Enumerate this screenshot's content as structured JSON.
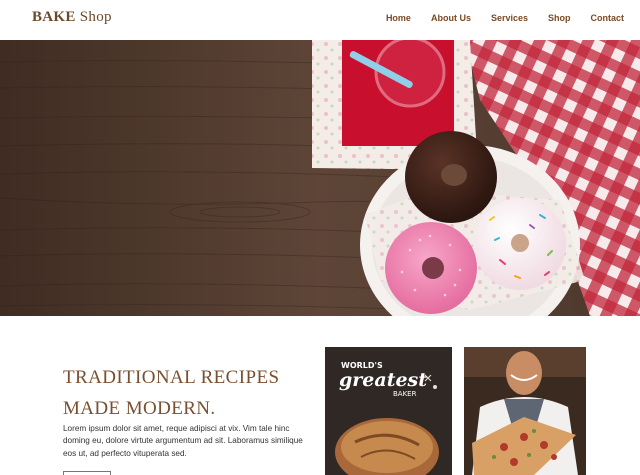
{
  "brand": {
    "bold": "BAKE",
    "rest": " Shop"
  },
  "nav": [
    "Home",
    "About Us",
    "Services",
    "Shop",
    "Contact"
  ],
  "headline": {
    "line1": "TRADITIONAL RECIPES",
    "line2": "MADE MODERN."
  },
  "paragraph": "Lorem ipsum dolor sit amet, reque adipisci at vix. Vim tale hinc doming eu, dolore virtute argumentum ad sit. Laboramus similique eos ut, ad perfecto vituperata sed.",
  "card1": {
    "small": "WORLD'S",
    "big": "greatest",
    "sub": "BAKER"
  },
  "colors": {
    "brand": "#6b4a2b",
    "nav": "#7a4a26",
    "headline": "#7a4f30",
    "wood": "#5a4234",
    "napkin_red": "#c8102e"
  }
}
